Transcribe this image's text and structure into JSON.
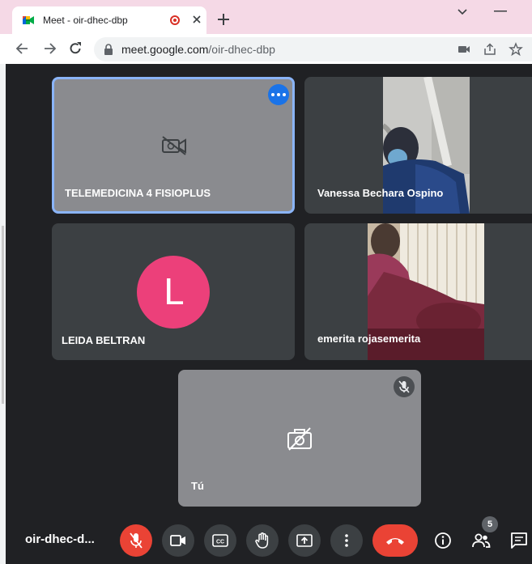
{
  "browser": {
    "tab_title": "Meet - oir-dhec-dbp",
    "url_host": "meet.google.com",
    "url_path": "/oir-dhec-dbp"
  },
  "participants": [
    {
      "name": "TELEMEDICINA 4 FISIOPLUS",
      "state": "camera-off",
      "active_speaker": true
    },
    {
      "name": "Vanessa Bechara Ospino",
      "state": "video"
    },
    {
      "name": "LEIDA BELTRAN",
      "state": "avatar",
      "avatar_letter": "L",
      "avatar_color": "#ec407a"
    },
    {
      "name": "emerita rojasemerita",
      "state": "video"
    },
    {
      "name": "Tú",
      "state": "camera-off",
      "muted": true
    }
  ],
  "bottom_bar": {
    "meeting_code": "oir-dhec-d...",
    "participant_count": "5"
  },
  "colors": {
    "accent": "#1a73e8",
    "danger": "#ea4335",
    "tile": "#3c4043",
    "background": "#202124"
  }
}
